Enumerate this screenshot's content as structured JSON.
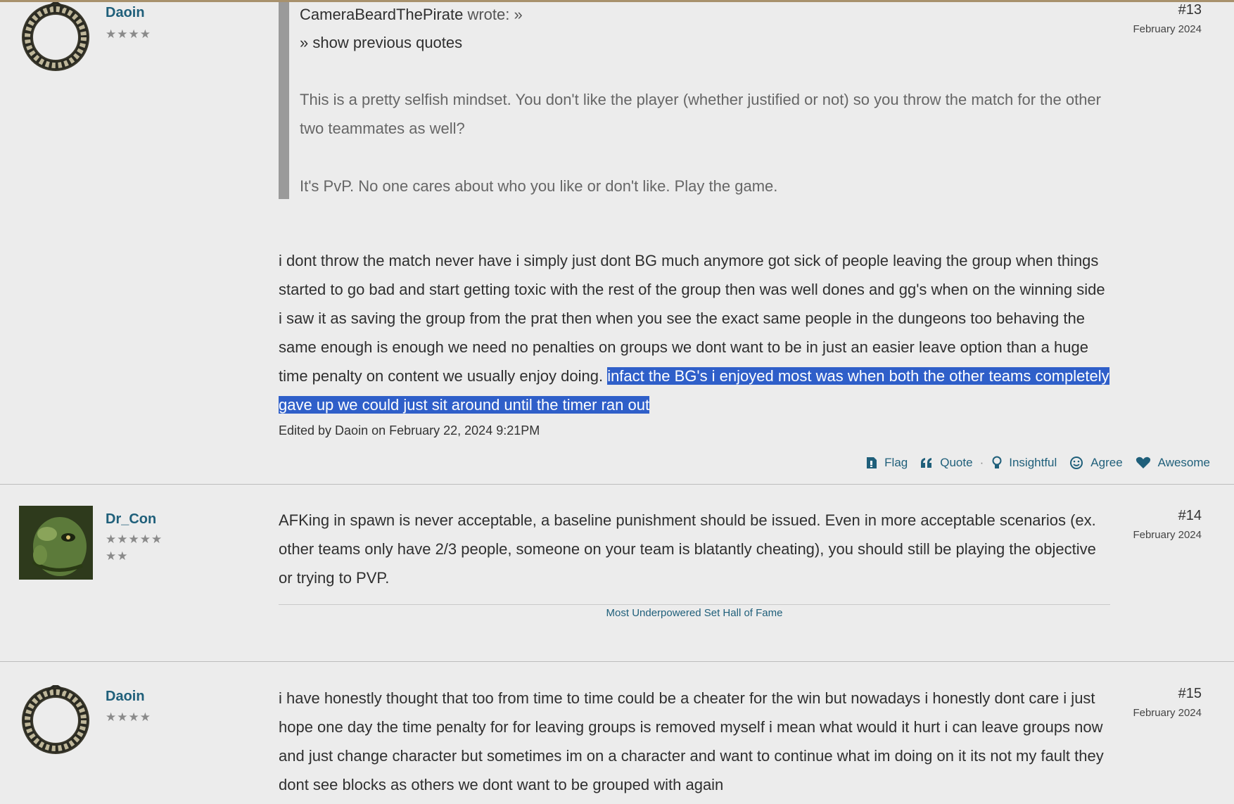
{
  "posts": [
    {
      "author": "Daoin",
      "stars": "★★★★",
      "number": "#13",
      "date": "February 2024",
      "quote": {
        "author": "CameraBeardThePirate",
        "wrote": "wrote: »",
        "toggle": "» show previous quotes",
        "paragraph1": "This is a pretty selfish mindset. You don't like the player (whether justified or not) so you throw the match for the other two teammates as well?",
        "paragraph2": "It's PvP. No one cares about who you like or don't like. Play the game."
      },
      "text_plain": "i dont throw the match never have i simply just dont BG much anymore got sick of people leaving the group when things started to go bad and start getting toxic with the rest of the group then was well dones and gg's when on the winning side i saw it as saving the group from the prat then when you see the exact same people in the dungeons too behaving the same enough is enough we need no penalties on groups we dont want to be in just an easier leave option than a huge time penalty on content we usually enjoy doing. ",
      "text_selected": "infact the BG's i enjoyed most was when both the other teams completely gave up we could just sit around until the timer ran out",
      "edited": "Edited by Daoin on February 22, 2024 9:21PM",
      "reactions": {
        "flag": "Flag",
        "quote": "Quote",
        "separator": "·",
        "insightful": "Insightful",
        "agree": "Agree",
        "awesome": "Awesome"
      }
    },
    {
      "author": "Dr_Con",
      "stars_line1": "★★★★★",
      "stars_line2": "★★",
      "number": "#14",
      "date": "February 2024",
      "text": "AFKing in spawn is never acceptable, a baseline punishment should be issued. Even in more acceptable scenarios (ex. other teams only have 2/3 people, someone on your team is blatantly cheating), you should still be playing the objective or trying to PVP.",
      "signature": "Most Underpowered Set Hall of Fame"
    },
    {
      "author": "Daoin",
      "stars": "★★★★",
      "number": "#15",
      "date": "February 2024",
      "text": "i have honestly thought that too from time to time could be a cheater for the win but nowadays i honestly dont care i just hope one day the time penalty for for leaving groups is removed myself i mean what would it hurt i can leave groups now and just change character but sometimes im on a character and want to continue what im doing on it its not my fault they dont see blocks as others we dont want to be grouped with again"
    }
  ],
  "colors": {
    "background": "#ececec",
    "link": "#1f5f7a",
    "selection": "#2f5fc9",
    "quote_bar": "#9a9a9a"
  }
}
